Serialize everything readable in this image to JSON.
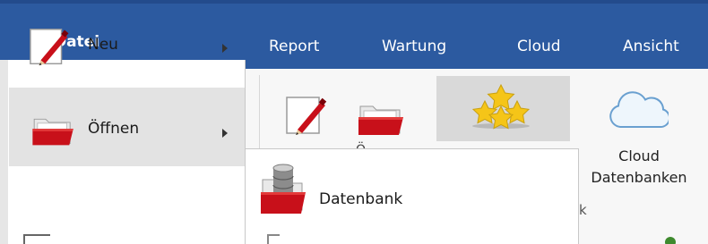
{
  "ribbon": {
    "tabs": [
      "Report",
      "Wartung",
      "Cloud",
      "Ansicht"
    ],
    "cloud_button_label_line1": "Cloud",
    "cloud_button_label_line2": "Datenbanken",
    "group_label_partial": "k",
    "open_label_partial": "Ö"
  },
  "file_menu": {
    "tab_label": "Datei",
    "items": [
      {
        "label": "Neu",
        "icon": "new-document-icon",
        "has_submenu": true
      },
      {
        "label": "Öffnen",
        "icon": "open-folder-icon",
        "has_submenu": true,
        "active": true
      }
    ]
  },
  "submenu": {
    "items": [
      {
        "label": "Datenbank",
        "icon": "database-folder-icon"
      }
    ]
  },
  "colors": {
    "ribbon_blue": "#2c5aa0",
    "folder_red": "#c8101a",
    "hover_gray": "#e3e3e3"
  }
}
